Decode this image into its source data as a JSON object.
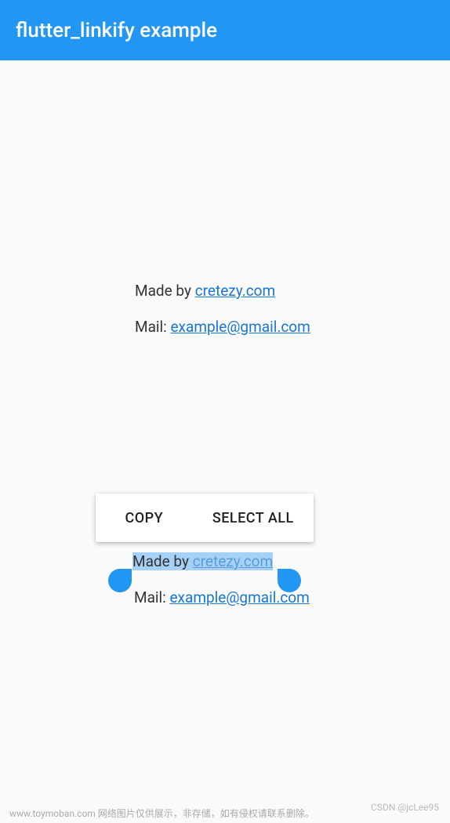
{
  "appBar": {
    "title": "flutter_linkify example"
  },
  "textBlock1": {
    "prefix": "Made by ",
    "link": "cretezy.com"
  },
  "textBlock2": {
    "prefix": "Mail: ",
    "link": "example@gmail.com"
  },
  "textBlock3": {
    "prefix": "Made by ",
    "link": "cretezy.com"
  },
  "textBlock4": {
    "prefix": "Mail: ",
    "link": "example@gmail.com"
  },
  "toolbar": {
    "copy": "COPY",
    "selectAll": "SELECT ALL"
  },
  "footer": {
    "left": "www.toymoban.com 网络图片仅供展示，非存储，如有侵权请联系删除。",
    "right": "CSDN @jcLee95"
  }
}
